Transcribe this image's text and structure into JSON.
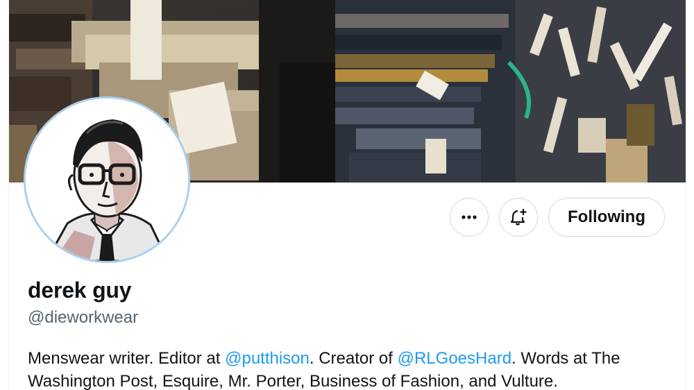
{
  "profile": {
    "display_name": "derek guy",
    "handle": "@dieworkwear",
    "bio": {
      "part1": "Menswear writer. Editor at ",
      "mention1": "@putthison",
      "part2": ". Creator of ",
      "mention2": "@RLGoesHard",
      "part3": ". Words at The Washington Post, Esquire, Mr. Porter, Business of Fashion, and Vulture."
    }
  },
  "actions": {
    "more_icon": "more-horizontal-icon",
    "notify_icon": "bell-plus-icon",
    "following_label": "Following"
  },
  "colors": {
    "accent": "#1d9bf0",
    "text_primary": "#0f1419",
    "text_secondary": "#536471",
    "border": "#cfd9de",
    "avatar_ring": "#a8d0f0"
  },
  "banner": {
    "description_icon": "fabric-rolls-banner-image"
  }
}
